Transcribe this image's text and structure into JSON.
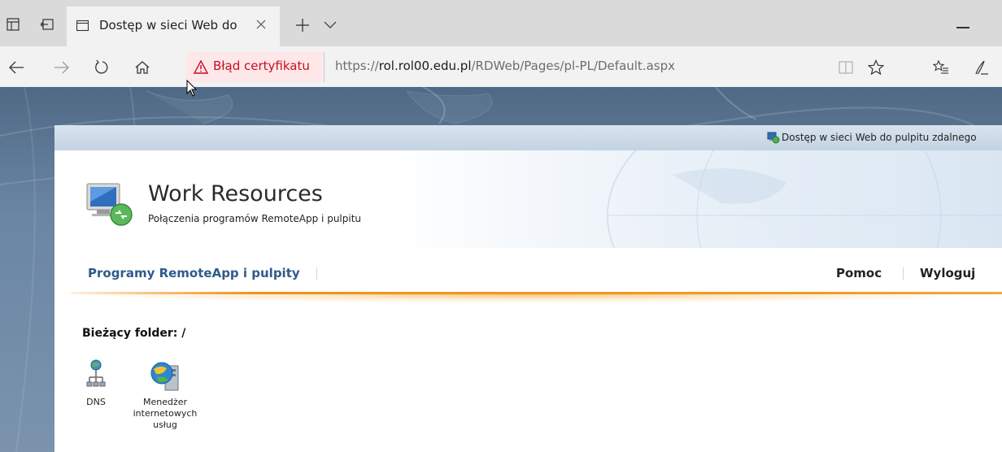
{
  "browser": {
    "tab": {
      "title": "Dostęp w sieci Web do"
    },
    "address": {
      "cert_warning": "Błąd certyfikatu",
      "url_scheme": "https://",
      "url_host": "rol.rol00.edu.pl",
      "url_path": "/RDWeb/Pages/pl-PL/Default.aspx"
    },
    "icons": [
      "tab-aside-icon",
      "set-aside-icon",
      "document-icon",
      "close-icon",
      "new-tab-icon",
      "chevron-down-icon",
      "minimize-icon",
      "back-icon",
      "forward-icon",
      "refresh-icon",
      "home-icon",
      "warning-icon",
      "reading-view-icon",
      "favorite-star-icon",
      "favorites-hub-icon",
      "web-note-icon"
    ]
  },
  "page": {
    "top_bar_text": "Dostęp w sieci Web do pulpitu zdalnego",
    "title": "Work Resources",
    "subtitle": "Połączenia programów RemoteApp i pulpitu",
    "nav": {
      "primary": "Programy RemoteApp i pulpity",
      "help": "Pomoc",
      "logout": "Wyloguj"
    },
    "folder_label": "Bieżący folder: /",
    "apps": [
      {
        "name": "DNS",
        "icon": "dns-icon"
      },
      {
        "name_lines": [
          "Menedżer",
          "internetowych",
          "usług"
        ],
        "icon": "iis-manager-icon"
      }
    ],
    "colors": {
      "nav_link": "#2f5b8a",
      "accent_orange": "#f0921e",
      "cert_error": "#c50f1f"
    }
  }
}
